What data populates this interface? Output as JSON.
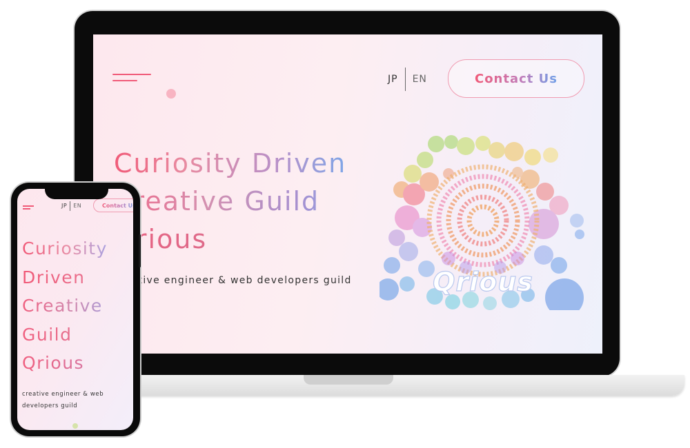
{
  "laptop": {
    "lang": {
      "jp": "JP",
      "en": "EN"
    },
    "contact_label": "Contact Us",
    "hero": {
      "line1": "Curiosity Driven",
      "line2": "Creative Guild",
      "line3": "Qrious"
    },
    "subtitle": "creative engineer & web developers guild",
    "logo_text": "Qrious",
    "menu_icon": "hamburger-menu-icon"
  },
  "phone": {
    "lang": {
      "jp": "JP",
      "en": "EN"
    },
    "contact_label": "Contact Us",
    "hero": [
      "Curiosity",
      "Driven",
      "Creative",
      "Guild",
      "Qrious"
    ],
    "subtitle": "creative engineer & web developers guild",
    "menu_icon": "hamburger-menu-icon"
  },
  "colors": {
    "accent_pink": "#f05a78",
    "accent_purple": "#c27bb8",
    "accent_blue": "#6f9fe8",
    "button_border": "#f09ab0"
  }
}
